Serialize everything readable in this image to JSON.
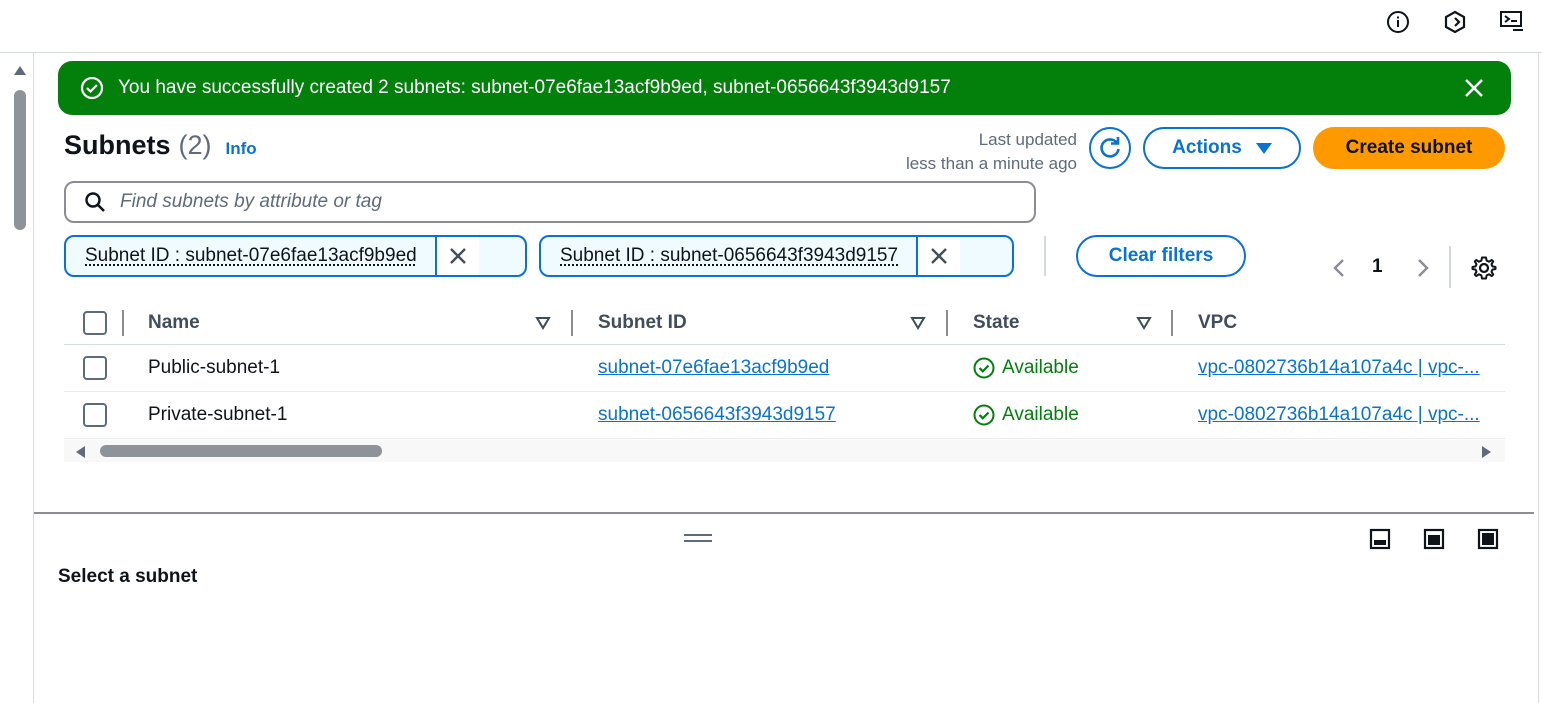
{
  "top_icons": [
    "info-icon",
    "cloudshell-icon",
    "remote-desktop-icon"
  ],
  "flash": {
    "message": "You have successfully created 2 subnets: subnet-07e6fae13acf9b9ed, subnet-0656643f3943d9157",
    "color": "#037f0c"
  },
  "header": {
    "title": "Subnets",
    "count": "(2)",
    "info": "Info",
    "last_updated_label": "Last updated",
    "last_updated_value": "less than a minute ago",
    "actions_label": "Actions",
    "create_label": "Create subnet"
  },
  "search": {
    "placeholder": "Find subnets by attribute or tag"
  },
  "filters": [
    {
      "label": "Subnet ID : subnet-07e6fae13acf9b9ed"
    },
    {
      "label": "Subnet ID : subnet-0656643f3943d9157"
    }
  ],
  "clear_filters_label": "Clear filters",
  "pagination": {
    "current_page": "1"
  },
  "table": {
    "columns": [
      "Name",
      "Subnet ID",
      "State",
      "VPC"
    ],
    "rows": [
      {
        "name": "Public-subnet-1",
        "subnet_id": "subnet-07e6fae13acf9b9ed",
        "state": "Available",
        "vpc": "vpc-0802736b14a107a4c | vpc-..."
      },
      {
        "name": "Private-subnet-1",
        "subnet_id": "subnet-0656643f3943d9157",
        "state": "Available",
        "vpc": "vpc-0802736b14a107a4c | vpc-..."
      }
    ]
  },
  "details_panel": {
    "message": "Select a subnet"
  },
  "colors": {
    "accent": "#0972d3",
    "primary_button": "#ff9900",
    "success": "#037f0c"
  }
}
